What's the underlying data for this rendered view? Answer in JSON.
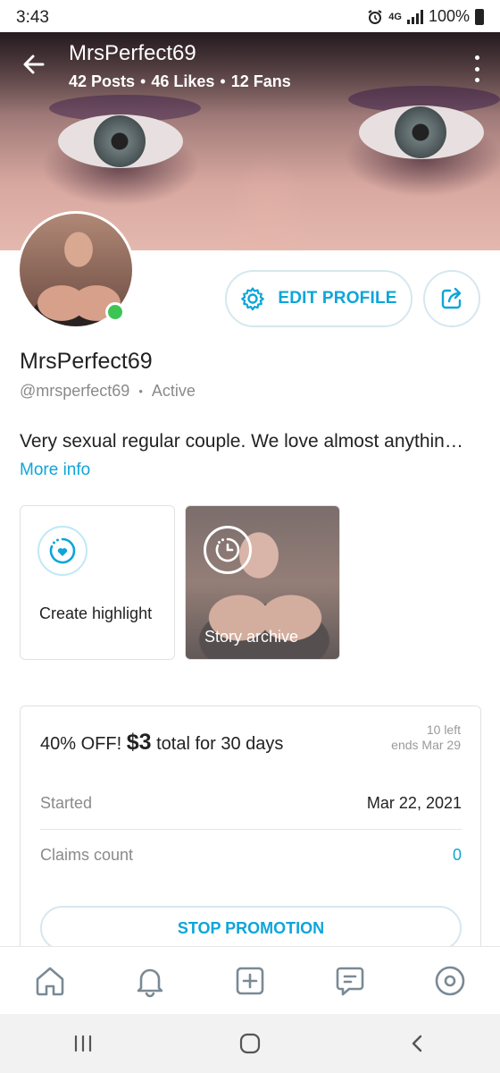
{
  "status_bar": {
    "time": "3:43",
    "network": "4G",
    "battery": "100%"
  },
  "header": {
    "title": "MrsPerfect69",
    "stats": {
      "posts": "42 Posts",
      "likes": "46 Likes",
      "fans": "12 Fans",
      "separator": "•"
    }
  },
  "profile": {
    "name": "MrsPerfect69",
    "handle": "@mrsperfect69",
    "status": "Active",
    "status_separator": "•",
    "bio": "Very sexual regular couple. We love almost anythin…",
    "more_info": "More info",
    "online_color": "#3cc553"
  },
  "buttons": {
    "edit_profile": "EDIT PROFILE",
    "accent_color": "#0ea5d9"
  },
  "highlights": {
    "create_label": "Create highlight",
    "archive_label": "Story archive"
  },
  "promotion": {
    "discount": "40% OFF!",
    "price": "$3",
    "duration": "total for 30 days",
    "left": "10 left",
    "ends": "ends Mar 29",
    "started_label": "Started",
    "started_value": "Mar 22, 2021",
    "claims_label": "Claims count",
    "claims_value": "0",
    "stop_label": "STOP PROMOTION"
  },
  "bottom_nav": {
    "items": [
      "home-icon",
      "bell-icon",
      "plus-square-icon",
      "message-icon",
      "profile-icon"
    ]
  },
  "system_nav": {
    "items": [
      "recent-apps-icon",
      "home-circle-icon",
      "back-chevron-icon"
    ]
  }
}
